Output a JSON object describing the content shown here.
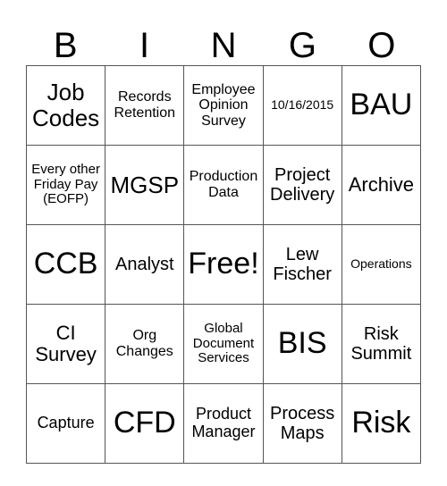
{
  "header": {
    "letters": [
      "B",
      "I",
      "N",
      "G",
      "O"
    ]
  },
  "board": {
    "rows": [
      [
        "Job Codes",
        "Records Retention",
        "Employee Opinion Survey",
        "10/16/2015",
        "BAU"
      ],
      [
        "Every other Friday Pay (EOFP)",
        "MGSP",
        "Production Data",
        "Project Delivery",
        "Archive"
      ],
      [
        "CCB",
        "Analyst",
        "Free!",
        "Lew Fischer",
        "Operations"
      ],
      [
        "CI Survey",
        "Org Changes",
        "Global Document Services",
        "BIS",
        "Risk Summit"
      ],
      [
        "Capture",
        "CFD",
        "Product Manager",
        "Process Maps",
        "Risk"
      ]
    ]
  }
}
